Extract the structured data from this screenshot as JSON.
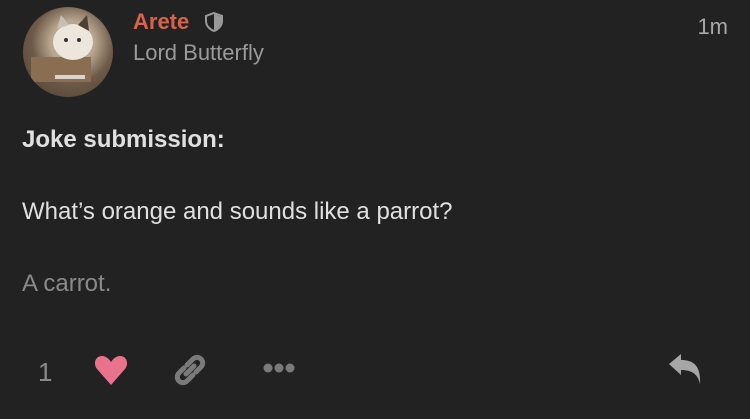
{
  "post": {
    "author": "Arete",
    "author_title": "Lord Butterfly",
    "timestamp": "1m",
    "body": {
      "heading": "Joke submission:",
      "question": "What’s orange and sounds like a parrot?",
      "answer": "A carrot."
    },
    "actions": {
      "like_count": "1"
    },
    "colors": {
      "author": "#d8634c",
      "heart": "#e9738c",
      "background": "#222222"
    }
  }
}
